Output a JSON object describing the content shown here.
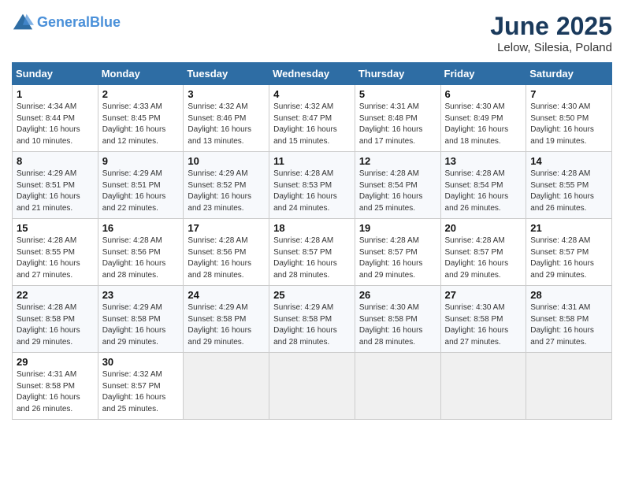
{
  "header": {
    "logo_line1": "General",
    "logo_line2": "Blue",
    "month": "June 2025",
    "location": "Lelow, Silesia, Poland"
  },
  "weekdays": [
    "Sunday",
    "Monday",
    "Tuesday",
    "Wednesday",
    "Thursday",
    "Friday",
    "Saturday"
  ],
  "weeks": [
    [
      {
        "day": "1",
        "sunrise": "4:34 AM",
        "sunset": "8:44 PM",
        "daylight": "16 hours and 10 minutes."
      },
      {
        "day": "2",
        "sunrise": "4:33 AM",
        "sunset": "8:45 PM",
        "daylight": "16 hours and 12 minutes."
      },
      {
        "day": "3",
        "sunrise": "4:32 AM",
        "sunset": "8:46 PM",
        "daylight": "16 hours and 13 minutes."
      },
      {
        "day": "4",
        "sunrise": "4:32 AM",
        "sunset": "8:47 PM",
        "daylight": "16 hours and 15 minutes."
      },
      {
        "day": "5",
        "sunrise": "4:31 AM",
        "sunset": "8:48 PM",
        "daylight": "16 hours and 17 minutes."
      },
      {
        "day": "6",
        "sunrise": "4:30 AM",
        "sunset": "8:49 PM",
        "daylight": "16 hours and 18 minutes."
      },
      {
        "day": "7",
        "sunrise": "4:30 AM",
        "sunset": "8:50 PM",
        "daylight": "16 hours and 19 minutes."
      }
    ],
    [
      {
        "day": "8",
        "sunrise": "4:29 AM",
        "sunset": "8:51 PM",
        "daylight": "16 hours and 21 minutes."
      },
      {
        "day": "9",
        "sunrise": "4:29 AM",
        "sunset": "8:51 PM",
        "daylight": "16 hours and 22 minutes."
      },
      {
        "day": "10",
        "sunrise": "4:29 AM",
        "sunset": "8:52 PM",
        "daylight": "16 hours and 23 minutes."
      },
      {
        "day": "11",
        "sunrise": "4:28 AM",
        "sunset": "8:53 PM",
        "daylight": "16 hours and 24 minutes."
      },
      {
        "day": "12",
        "sunrise": "4:28 AM",
        "sunset": "8:54 PM",
        "daylight": "16 hours and 25 minutes."
      },
      {
        "day": "13",
        "sunrise": "4:28 AM",
        "sunset": "8:54 PM",
        "daylight": "16 hours and 26 minutes."
      },
      {
        "day": "14",
        "sunrise": "4:28 AM",
        "sunset": "8:55 PM",
        "daylight": "16 hours and 26 minutes."
      }
    ],
    [
      {
        "day": "15",
        "sunrise": "4:28 AM",
        "sunset": "8:55 PM",
        "daylight": "16 hours and 27 minutes."
      },
      {
        "day": "16",
        "sunrise": "4:28 AM",
        "sunset": "8:56 PM",
        "daylight": "16 hours and 28 minutes."
      },
      {
        "day": "17",
        "sunrise": "4:28 AM",
        "sunset": "8:56 PM",
        "daylight": "16 hours and 28 minutes."
      },
      {
        "day": "18",
        "sunrise": "4:28 AM",
        "sunset": "8:57 PM",
        "daylight": "16 hours and 28 minutes."
      },
      {
        "day": "19",
        "sunrise": "4:28 AM",
        "sunset": "8:57 PM",
        "daylight": "16 hours and 29 minutes."
      },
      {
        "day": "20",
        "sunrise": "4:28 AM",
        "sunset": "8:57 PM",
        "daylight": "16 hours and 29 minutes."
      },
      {
        "day": "21",
        "sunrise": "4:28 AM",
        "sunset": "8:57 PM",
        "daylight": "16 hours and 29 minutes."
      }
    ],
    [
      {
        "day": "22",
        "sunrise": "4:28 AM",
        "sunset": "8:58 PM",
        "daylight": "16 hours and 29 minutes."
      },
      {
        "day": "23",
        "sunrise": "4:29 AM",
        "sunset": "8:58 PM",
        "daylight": "16 hours and 29 minutes."
      },
      {
        "day": "24",
        "sunrise": "4:29 AM",
        "sunset": "8:58 PM",
        "daylight": "16 hours and 29 minutes."
      },
      {
        "day": "25",
        "sunrise": "4:29 AM",
        "sunset": "8:58 PM",
        "daylight": "16 hours and 28 minutes."
      },
      {
        "day": "26",
        "sunrise": "4:30 AM",
        "sunset": "8:58 PM",
        "daylight": "16 hours and 28 minutes."
      },
      {
        "day": "27",
        "sunrise": "4:30 AM",
        "sunset": "8:58 PM",
        "daylight": "16 hours and 27 minutes."
      },
      {
        "day": "28",
        "sunrise": "4:31 AM",
        "sunset": "8:58 PM",
        "daylight": "16 hours and 27 minutes."
      }
    ],
    [
      {
        "day": "29",
        "sunrise": "4:31 AM",
        "sunset": "8:58 PM",
        "daylight": "16 hours and 26 minutes."
      },
      {
        "day": "30",
        "sunrise": "4:32 AM",
        "sunset": "8:57 PM",
        "daylight": "16 hours and 25 minutes."
      },
      null,
      null,
      null,
      null,
      null
    ]
  ]
}
